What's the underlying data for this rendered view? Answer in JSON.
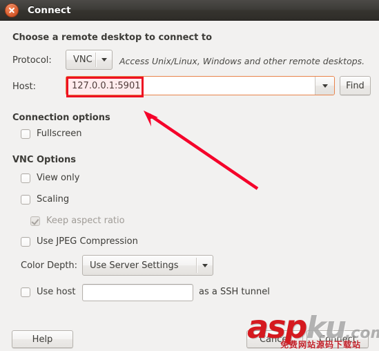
{
  "window": {
    "title": "Connect",
    "close_icon": "close-icon"
  },
  "main": {
    "heading": "Choose a remote desktop to connect to",
    "protocol": {
      "label": "Protocol:",
      "value": "VNC",
      "hint": "Access Unix/Linux, Windows and other remote desktops.",
      "arrow_icon": "chevron-down-icon"
    },
    "host": {
      "label": "Host:",
      "value": "127.0.0.1:5901",
      "placeholder": "",
      "find_label": "Find",
      "arrow_icon": "chevron-down-icon"
    },
    "connection_options": {
      "heading": "Connection options",
      "items": [
        {
          "label": "Fullscreen",
          "checked": false,
          "disabled": false
        }
      ]
    },
    "vnc_options": {
      "heading": "VNC Options",
      "items": [
        {
          "label": "View only",
          "checked": false,
          "disabled": false
        },
        {
          "label": "Scaling",
          "checked": false,
          "disabled": false
        },
        {
          "label": "Keep aspect ratio",
          "checked": true,
          "disabled": true
        },
        {
          "label": "Use JPEG Compression",
          "checked": false,
          "disabled": false
        }
      ]
    },
    "color_depth": {
      "label": "Color Depth:",
      "value": "Use Server Settings",
      "arrow_icon": "chevron-down-icon"
    },
    "ssh_tunnel": {
      "checkbox_label": "Use host",
      "checked": false,
      "host_value": "",
      "suffix_label": "as a SSH tunnel"
    }
  },
  "footer": {
    "help_label": "Help",
    "cancel_label": "Cancel",
    "connect_label": "Connect"
  },
  "annotations": {
    "highlight_target": "host-field-value",
    "arrow_color": "#f5012a",
    "box_color": "#ee1122"
  },
  "watermark": {
    "part_red": "asp",
    "part_gray": "ku",
    "part_com": ".com",
    "subtitle": "免费网站源码下载站"
  }
}
